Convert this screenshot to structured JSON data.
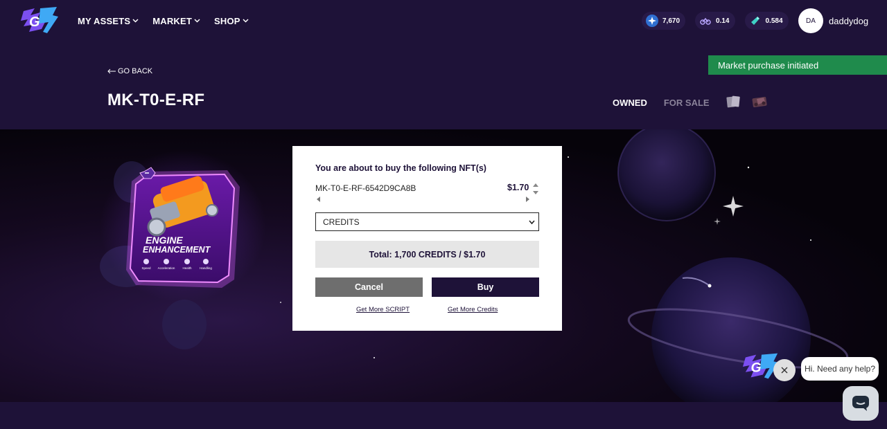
{
  "nav": {
    "items": [
      {
        "label": "MY ASSETS"
      },
      {
        "label": "MARKET"
      },
      {
        "label": "SHOP"
      }
    ]
  },
  "balances": [
    {
      "icon": "star-token-icon",
      "value": "7,670",
      "color": "#3a7bd5"
    },
    {
      "icon": "motorbike-token-icon",
      "value": "0.14",
      "color": "#7b6bd6"
    },
    {
      "icon": "crystal-token-icon",
      "value": "0.584",
      "color": "#3fd1c6"
    }
  ],
  "user": {
    "initials": "DA",
    "name": "daddydog"
  },
  "toast": {
    "message": "Market purchase initiated",
    "color": "#1f8b4c"
  },
  "header": {
    "back_label": "GO BACK",
    "title": "MK-T0-E-RF",
    "tabs": [
      {
        "label": "OWNED",
        "active": true
      },
      {
        "label": "FOR SALE",
        "active": false
      }
    ]
  },
  "card": {
    "title_line1": "ENGINE",
    "title_line2": "ENHANCEMENT",
    "stats": [
      "Speed",
      "Acceleration",
      "Health",
      "Handling"
    ]
  },
  "modal": {
    "heading": "You are about to buy the following NFT(s)",
    "nft_id": "MK-T0-E-RF-6542D9CA8B",
    "price": "$1.70",
    "currency_selected": "CREDITS",
    "total": "Total: 1,700 CREDITS / $1.70",
    "cancel_label": "Cancel",
    "buy_label": "Buy",
    "link_script": "Get More SCRIPT",
    "link_credits": "Get More Credits"
  },
  "chat": {
    "greeting": "Hi. Need any help?"
  }
}
